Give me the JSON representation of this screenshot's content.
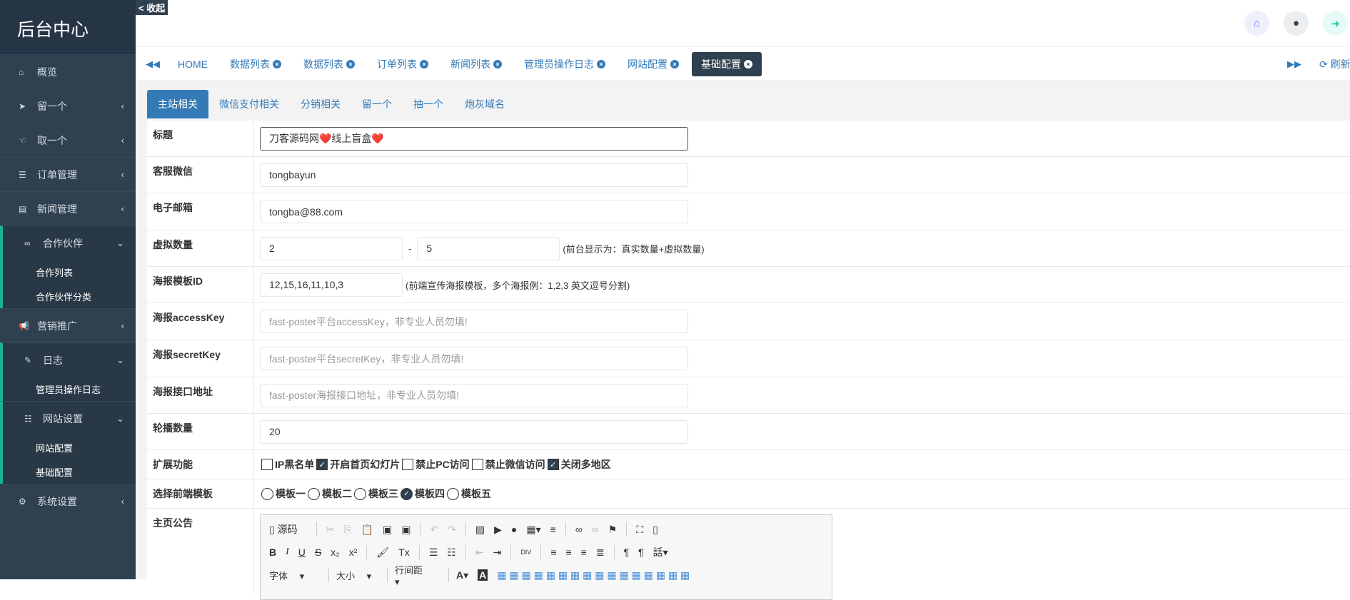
{
  "sidebar": {
    "logo": "后台中心",
    "collapse": "< 收起",
    "items": [
      {
        "label": "概览",
        "icon": "home-icon"
      },
      {
        "label": "留一个",
        "icon": "paper-plane-icon"
      },
      {
        "label": "取一个",
        "icon": "hand-icon"
      },
      {
        "label": "订单管理",
        "icon": "list-icon"
      },
      {
        "label": "新闻管理",
        "icon": "newspaper-icon"
      },
      {
        "label": "合作伙伴",
        "icon": "handshake-icon"
      },
      {
        "label": "营销推广",
        "icon": "bullhorn-icon"
      },
      {
        "label": "日志",
        "icon": "edit-icon"
      },
      {
        "label": "网站设置",
        "icon": "sitemap-icon"
      },
      {
        "label": "系统设置",
        "icon": "gear-icon"
      }
    ],
    "sub_partner": [
      "合作列表",
      "合作伙伴分类"
    ],
    "sub_log": [
      "管理员操作日志"
    ],
    "sub_site": [
      "网站配置",
      "基础配置"
    ]
  },
  "tabs": {
    "home": "HOME",
    "items": [
      "数据列表",
      "数据列表",
      "订单列表",
      "新闻列表",
      "管理员操作日志",
      "网站配置",
      "基础配置"
    ],
    "refresh": "刷新"
  },
  "subtabs": [
    "主站相关",
    "微信支付相关",
    "分销相关",
    "留一个",
    "抽一个",
    "炮灰域名"
  ],
  "form": {
    "title": {
      "label": "标题",
      "value": "刀客源码网❤️线上盲盒❤️"
    },
    "wechat": {
      "label": "客服微信",
      "value": "tongbayun"
    },
    "email": {
      "label": "电子邮箱",
      "value": "tongba@88.com"
    },
    "virtual": {
      "label": "虚拟数量",
      "min": "2",
      "dash": "-",
      "max": "5",
      "hint": "(前台显示为：真实数量+虚拟数量)"
    },
    "poster_id": {
      "label": "海报模板ID",
      "value": "12,15,16,11,10,3",
      "hint": "(前端宣传海报模板，多个海报例：1,2,3 英文逗号分割)"
    },
    "access_key": {
      "label": "海报accessKey",
      "placeholder": "fast-poster平台accessKey，非专业人员勿填!"
    },
    "secret_key": {
      "label": "海报secretKey",
      "placeholder": "fast-poster平台secretKey，非专业人员勿填!"
    },
    "api_url": {
      "label": "海报接口地址",
      "placeholder": "fast-poster海报接口地址，非专业人员勿填!"
    },
    "carousel": {
      "label": "轮播数量",
      "value": "20"
    },
    "ext": {
      "label": "扩展功能",
      "options": [
        {
          "label": "IP黑名单",
          "checked": false
        },
        {
          "label": "开启首页幻灯片",
          "checked": true
        },
        {
          "label": "禁止PC访问",
          "checked": false
        },
        {
          "label": "禁止微信访问",
          "checked": false
        },
        {
          "label": "关闭多地区",
          "checked": true
        }
      ]
    },
    "template": {
      "label": "选择前端模板",
      "options": [
        "模板一",
        "模板二",
        "模板三",
        "模板四",
        "模板五"
      ],
      "selected": 3
    },
    "notice": {
      "label": "主页公告",
      "source": "源码",
      "font": "字体",
      "size": "大小",
      "line_height": "行间距"
    }
  }
}
